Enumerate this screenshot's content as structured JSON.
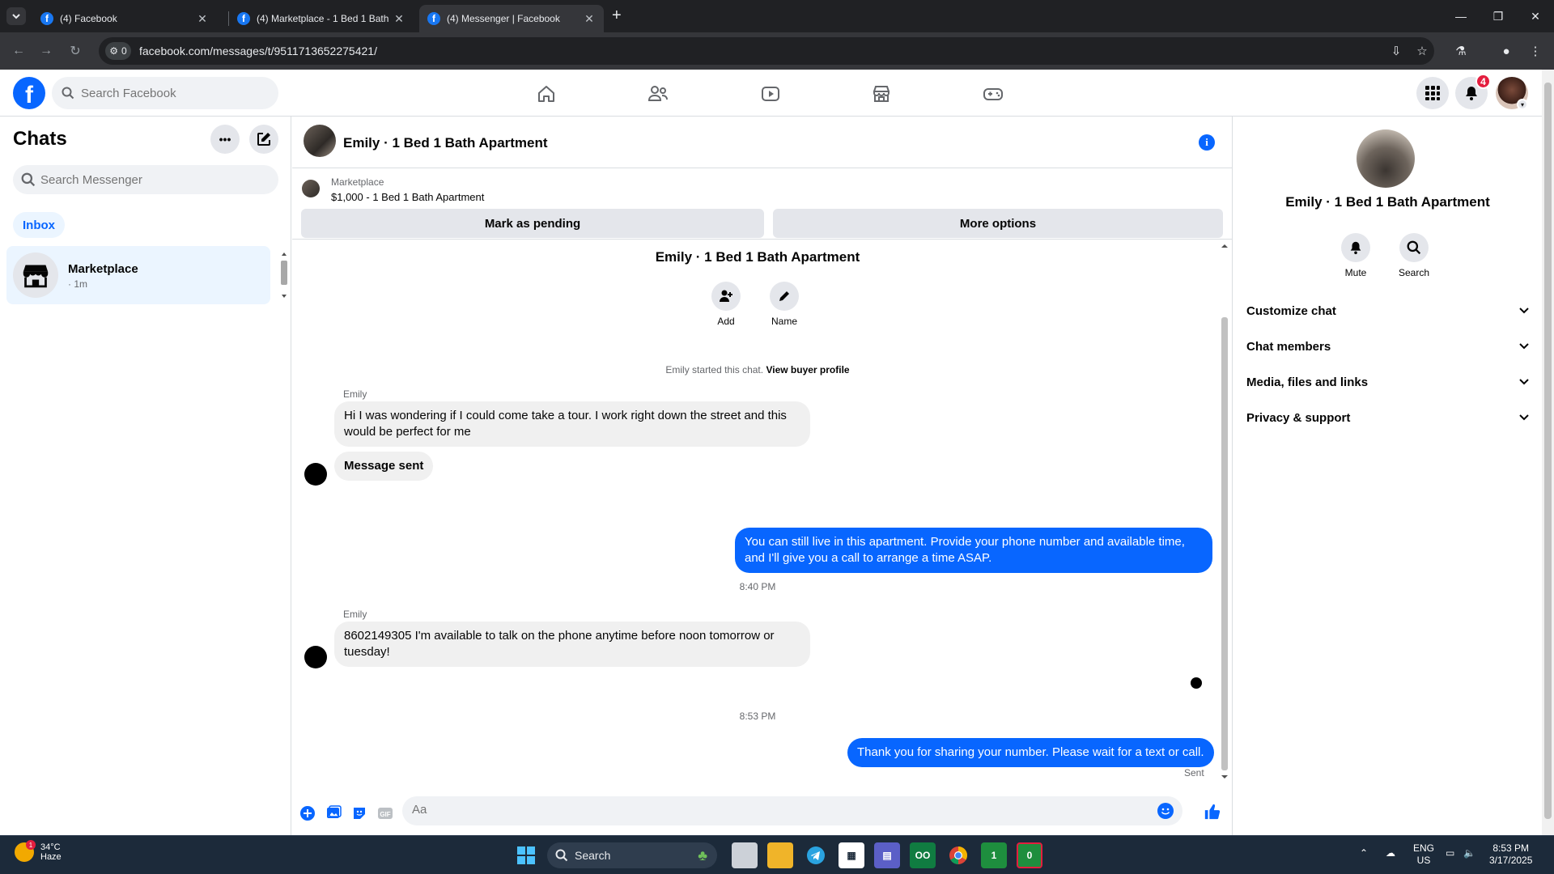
{
  "browser": {
    "tabs": [
      {
        "title": "(4) Facebook",
        "favicon": "f",
        "active": false
      },
      {
        "title": "(4) Marketplace - 1 Bed 1 Bath",
        "favicon": "f",
        "active": false
      },
      {
        "title": "(4) Messenger | Facebook",
        "favicon": "f",
        "active": true
      }
    ],
    "new_tab": "+",
    "site_info_count": "0",
    "url": "facebook.com/messages/t/9511713652275421/"
  },
  "fb": {
    "logo": "f",
    "search_placeholder": "Search Facebook",
    "notifications_count": "4"
  },
  "chats": {
    "title": "Chats",
    "search_placeholder": "Search Messenger",
    "inbox_label": "Inbox",
    "items": [
      {
        "name": "Marketplace",
        "sub": "· 1m"
      }
    ]
  },
  "conversation": {
    "title": "Emily · 1 Bed 1 Bath Apartment",
    "marketplace_label": "Marketplace",
    "listing": "$1,000 - 1 Bed 1 Bath Apartment",
    "mark_pending": "Mark as pending",
    "more_options": "More options",
    "center_title": "Emily · 1 Bed 1 Bath Apartment",
    "actions": {
      "add": "Add",
      "name": "Name"
    },
    "started_text": "Emily started this chat.",
    "view_buyer": "View buyer profile",
    "messages": {
      "sender1": "Emily",
      "msg1": "Hi I was wondering if I could come take a tour. I work right down the street and this would be perfect for me",
      "msg2": "Message sent",
      "out1": "You can still live in this apartment. Provide your phone number and available time, and I'll give you a call to arrange a time ASAP.",
      "time1": "8:40 PM",
      "sender2": "Emily",
      "msg3": "8602149305 I'm available to talk on the phone anytime before noon tomorrow or tuesday!",
      "time2": "8:53 PM",
      "out2": "Thank you for sharing your number. Please wait for a text or call.",
      "status": "Sent"
    },
    "composer_placeholder": "Aa"
  },
  "info_panel": {
    "name": "Emily · 1 Bed 1 Bath Apartment",
    "mute": "Mute",
    "search": "Search",
    "sections": [
      "Customize chat",
      "Chat members",
      "Media, files and links",
      "Privacy & support"
    ]
  },
  "taskbar": {
    "temp": "34°C",
    "condition": "Haze",
    "weather_badge": "1",
    "search": "Search",
    "lang_top": "ENG",
    "lang_bottom": "US",
    "time": "8:53 PM",
    "date": "3/17/2025",
    "app_badge_1": "1",
    "app_badge_2": "0"
  },
  "colors": {
    "accent": "#0866ff",
    "bubble_in": "#f0f0f0",
    "badge": "#e41e3f"
  }
}
